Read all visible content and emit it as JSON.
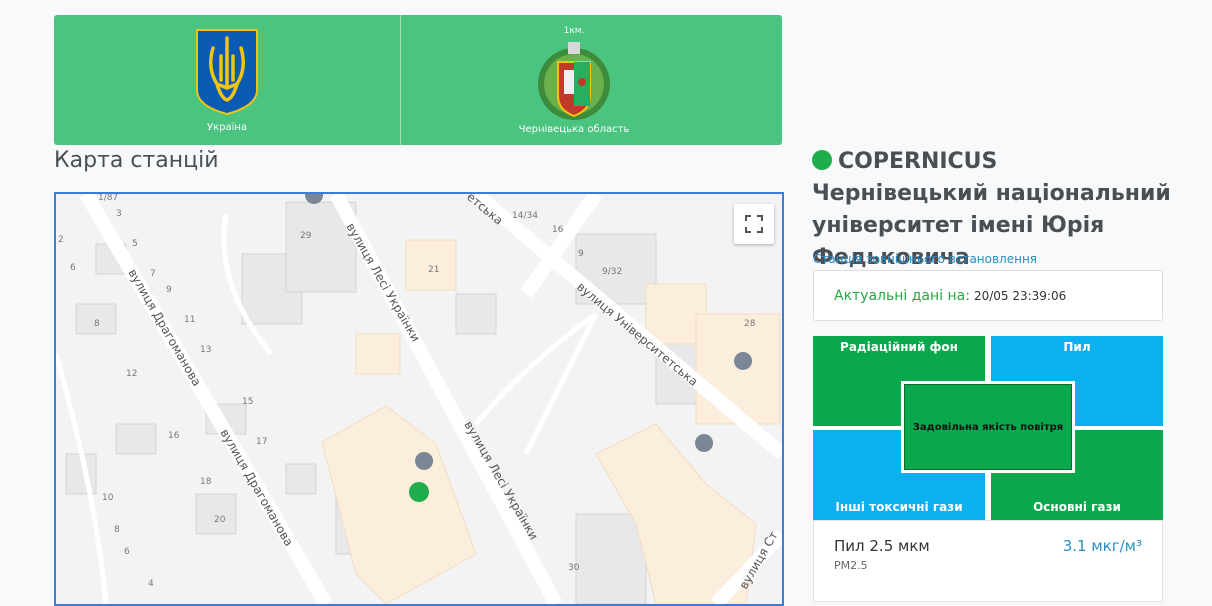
{
  "banner": {
    "left_caption": "Україна",
    "right_caption": "Чернівецька область",
    "right_top_label": "1км."
  },
  "map": {
    "title": "Карта станцій",
    "streets": [
      "вулиця Драгоманова",
      "вулиця Драгоманова",
      "вулиця Лесі Українки",
      "вулиця Лесі Українки",
      "вулиця Університетська",
      "етська",
      "вулиця Ст"
    ],
    "building_numbers": [
      "1/87",
      "3",
      "2",
      "5",
      "6",
      "7",
      "9",
      "8",
      "11",
      "13",
      "12",
      "15",
      "16",
      "17",
      "18",
      "20",
      "10",
      "8",
      "6",
      "4",
      "29",
      "21",
      "14/34",
      "16",
      "9",
      "9/32",
      "28",
      "30"
    ]
  },
  "station": {
    "name": "COPERNICUS Чернівецький національний університет імені Юрія Федьковича",
    "type": "Станція зовнішнього встановлення",
    "update_label": "Актуальні дані на:",
    "update_time": "20/05 23:39:06"
  },
  "quality": {
    "top_left": "Радіаційний фон",
    "top_right": "Пил",
    "bottom_left": "Інші токсичні гази",
    "bottom_right": "Основні гази",
    "center": "Задовільна якість повітря",
    "colors": {
      "green": "#0aa84c",
      "blue": "#0db0ef"
    }
  },
  "pm": {
    "name": "Пил 2.5 мкм",
    "code": "PM2.5",
    "value": "3.1 мкг/м³"
  }
}
